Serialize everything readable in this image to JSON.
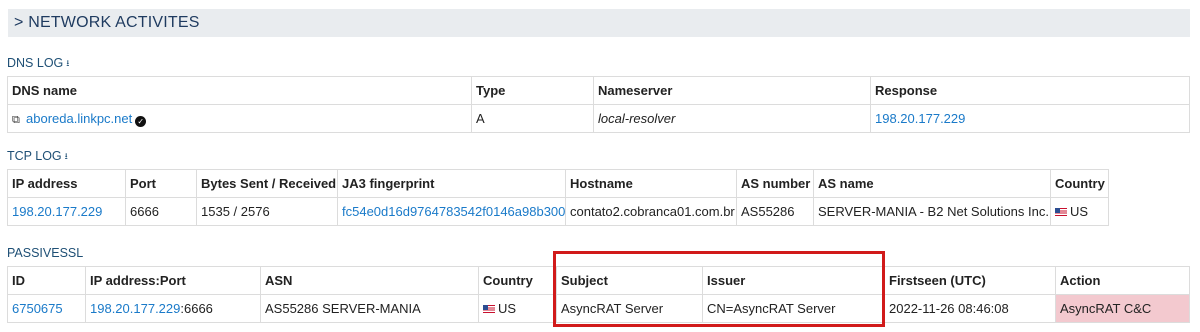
{
  "section": {
    "title": "> NETWORK ACTIVITES"
  },
  "dns": {
    "title": "DNS LOG",
    "download_icon": "download-icon",
    "headers": [
      "DNS name",
      "Type",
      "Nameserver",
      "Response"
    ],
    "row": {
      "dns_name": "aboreda.linkpc.net",
      "type": "A",
      "nameserver": "local-resolver",
      "response": "198.20.177.229"
    }
  },
  "tcp": {
    "title": "TCP LOG",
    "headers": [
      "IP address",
      "Port",
      "Bytes Sent / Received",
      "JA3 fingerprint",
      "Hostname",
      "AS number",
      "AS name",
      "Country"
    ],
    "row": {
      "ip": "198.20.177.229",
      "port": "6666",
      "bytes": "1535 / 2576",
      "ja3": "fc54e0d16d9764783542f0146a98b300",
      "hostname": "contato2.cobranca01.com.br",
      "as_number": "AS55286",
      "as_name": "SERVER-MANIA - B2 Net Solutions Inc.",
      "country": "US"
    }
  },
  "passivessl": {
    "title": "PASSIVESSL",
    "headers": [
      "ID",
      "IP address:Port",
      "ASN",
      "Country",
      "Subject",
      "Issuer",
      "Firstseen (UTC)",
      "Action"
    ],
    "row": {
      "id": "6750675",
      "ip": "198.20.177.229",
      "port_suffix": ":6666",
      "asn": "AS55286 SERVER-MANIA",
      "country": "US",
      "subject": "AsyncRAT Server",
      "issuer": "CN=AsyncRAT Server",
      "firstseen": "2022-11-26 08:46:08",
      "action": "AsyncRAT C&C"
    }
  },
  "colors": {
    "link": "#1a7ac9",
    "highlight_border": "#d11a1a",
    "action_bg": "#f3c9cf",
    "header_bg": "#e9ecef"
  }
}
